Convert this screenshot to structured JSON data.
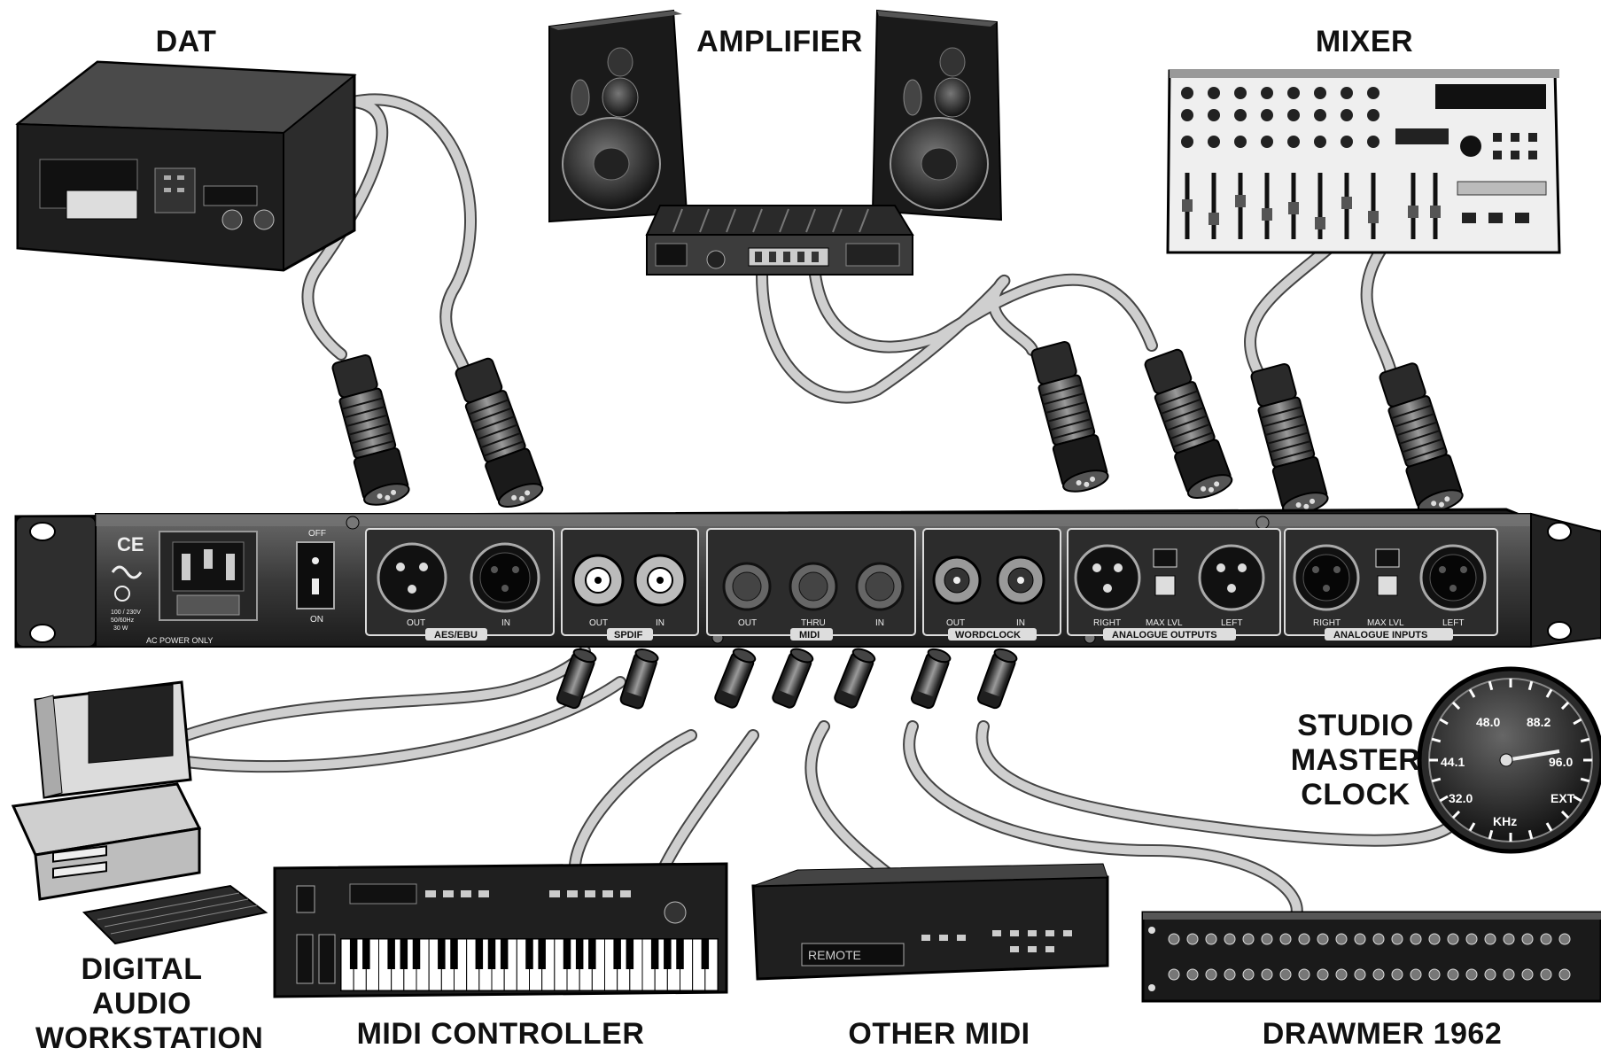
{
  "devices": {
    "dat": "DAT",
    "amplifier": "AMPLIFIER",
    "mixer": "MIXER",
    "daw": [
      "DIGITAL",
      "AUDIO",
      "WORKSTATION"
    ],
    "midi_controller": "MIDI CONTROLLER",
    "other_midi": "OTHER MIDI",
    "drawmer": "DRAWMER 1962",
    "studio_clock": [
      "STUDIO",
      "MASTER",
      "CLOCK"
    ]
  },
  "rack_panel": {
    "power": {
      "off": "OFF",
      "on": "ON",
      "ac_label": "AC POWER ONLY",
      "ce_mark": "CE",
      "voltage": [
        "100 / 230V",
        "50/60Hz",
        "30 W"
      ]
    },
    "sections": [
      {
        "name": "AES/EBU",
        "ports": [
          "OUT",
          "IN"
        ]
      },
      {
        "name": "SPDIF",
        "ports": [
          "OUT",
          "IN"
        ]
      },
      {
        "name": "MIDI",
        "ports": [
          "OUT",
          "THRU",
          "IN"
        ]
      },
      {
        "name": "WORDCLOCK",
        "ports": [
          "OUT",
          "IN"
        ]
      },
      {
        "name": "ANALOGUE OUTPUTS",
        "ports": [
          "RIGHT",
          "MAX LVL",
          "LEFT"
        ]
      },
      {
        "name": "ANALOGUE INPUTS",
        "ports": [
          "RIGHT",
          "MAX LVL",
          "LEFT"
        ]
      }
    ]
  },
  "clock_dial": {
    "labels": [
      "48.0",
      "88.2",
      "44.1",
      "96.0",
      "32.0",
      "EXT",
      "KHz"
    ]
  },
  "other_midi_display": "REMOTE",
  "colors": {
    "ink": "#111111",
    "metal": "#3a3a3a",
    "cable": "#c8c8c8",
    "cable_edge": "#555555",
    "panel": "#2b2b2b"
  }
}
